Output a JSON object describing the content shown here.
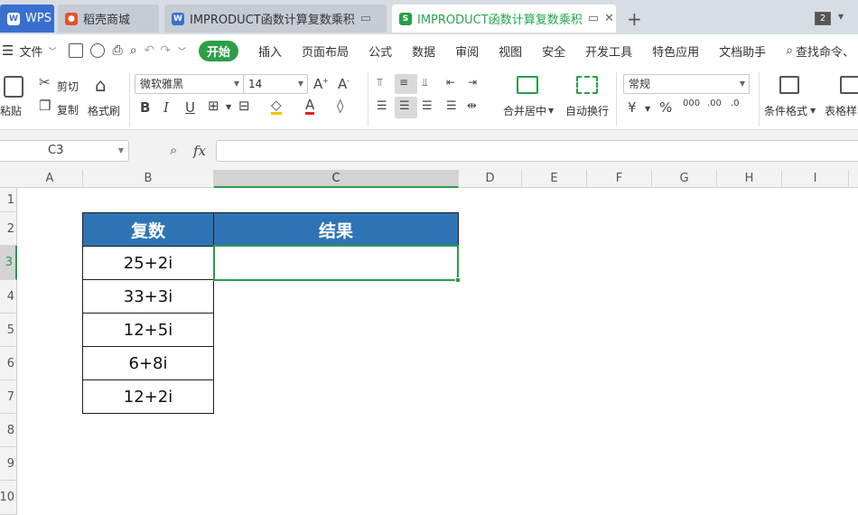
{
  "tabs": {
    "wps": "WPS",
    "daoke": "稻壳商城",
    "doc1": "IMPRODUCT函数计算复数乘积",
    "doc2": "IMPRODUCT函数计算复数乘积",
    "window_count": "2"
  },
  "menu": {
    "file": "文件",
    "items": [
      "开始",
      "插入",
      "页面布局",
      "公式",
      "数据",
      "审阅",
      "视图",
      "安全",
      "开发工具",
      "特色应用",
      "文档助手"
    ],
    "search": "查找命令、"
  },
  "ribbon": {
    "paste": "粘贴",
    "cut": "剪切",
    "copy": "复制",
    "format_painter": "格式刷",
    "font_name": "微软雅黑",
    "font_size": "14",
    "merge_center": "合并居中",
    "wrap_text": "自动换行",
    "number_format": "常规",
    "conditional_format": "条件格式",
    "table_style": "表格样"
  },
  "formula_bar": {
    "name_box": "C3",
    "fx": "fx",
    "content": ""
  },
  "grid": {
    "columns": [
      "A",
      "B",
      "C",
      "D",
      "E",
      "F",
      "G",
      "H",
      "I"
    ],
    "rows": [
      "1",
      "2",
      "3",
      "4",
      "5",
      "6",
      "7",
      "8",
      "9",
      "10"
    ],
    "selected_column": "C",
    "selected_row": "3"
  },
  "table": {
    "headers": [
      "复数",
      "结果"
    ],
    "complex_values": [
      "25+2i",
      "33+3i",
      "12+5i",
      "6+8i",
      "12+2i"
    ],
    "result_values": [
      "",
      "",
      "",
      "",
      ""
    ]
  },
  "colors": {
    "accent_green": "#2a9c4b",
    "header_blue": "#2e74b5",
    "wps_blue": "#3a6fd0"
  }
}
